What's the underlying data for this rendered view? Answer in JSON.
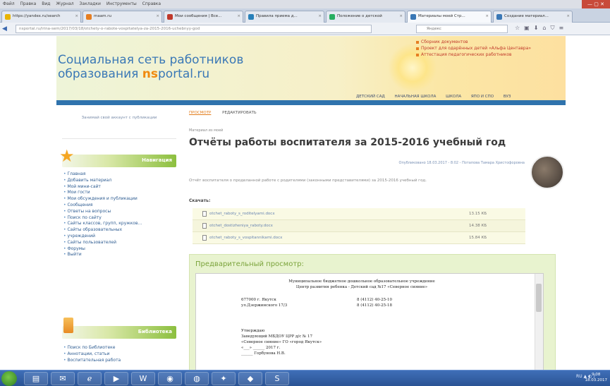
{
  "browser": {
    "menu": [
      "Файл",
      "Правка",
      "Вид",
      "Журнал",
      "Закладки",
      "Инструменты",
      "Справка"
    ],
    "tabs": [
      {
        "label": "https://yandex.ru/search",
        "active": false,
        "color": "#e9b400"
      },
      {
        "label": "maam.ru",
        "active": false,
        "color": "#e67e22"
      },
      {
        "label": "Мои сообщения | Все...",
        "active": false,
        "color": "#c0392b"
      },
      {
        "label": "Правила приема д...",
        "active": false,
        "color": "#2980b9"
      },
      {
        "label": "Положение о детской",
        "active": false,
        "color": "#27ae60"
      },
      {
        "label": "Материалы моей Стр...",
        "active": true,
        "color": "#3a78b6"
      },
      {
        "label": "Создание материал...",
        "active": false,
        "color": "#3a78b6"
      }
    ],
    "url": "nsportal.ru/irina-sem/2017/03/18/otchety-o-rabote-vospitatelya-za-2015-2016-uchebnyy-god",
    "search_placeholder": "Яндекс",
    "window_controls": "— ▢ ✕"
  },
  "header": {
    "logo_line1": "Социальная сеть работников",
    "logo_line2_a": "образования ",
    "logo_line2_b": "ns",
    "logo_line2_c": "portal.ru",
    "links": [
      "Сборник документов",
      "Проект для одарённых детей «Альфа Центавра»",
      "Аттестация педагогических работников"
    ],
    "categories": [
      "ДЕТСКИЙ САД",
      "НАЧАЛЬНАЯ ШКОЛА",
      "ШКОЛА",
      "ЯПО И СПО",
      "ВУЗ"
    ]
  },
  "sidebar": {
    "promo": "Занимай свой аккаунт с публикации",
    "nav_title": "Навигация",
    "nav_items": [
      "Главная",
      "Добавить материал",
      "Мой мини-сайт",
      "Мои гости",
      "Мои обсуждения и публикации",
      "Сообщения",
      "Ответы на вопросы",
      "Поиск по сайту",
      "Сайты классов, групп, кружков...",
      "Сайты образовательных",
      "учреждений",
      "Сайты пользователей",
      "Форумы",
      "Выйти"
    ],
    "lib_title": "Библиотека",
    "lib_items": [
      "Поиск по Библиотеке",
      "Аннотации, статьи",
      "Воспитательная работа"
    ]
  },
  "content": {
    "view_tabs": [
      "ПРОСМОТР",
      "РЕДАКТИРОВАТЬ"
    ],
    "breadcrumb": "Материал из моей",
    "title": "Отчёты работы воспитателя за 2015-2016 учебный год",
    "meta": "Опубликовано 18.03.2017 - 8:02 - Потапова Тамара Христофоровна",
    "description": "Отчёт воспитателя о проделанной работе с родителями (законными представителями) за 2015-2016 учебный год.",
    "download_label": "Скачать:",
    "files": [
      {
        "name": "otchet_raboty_s_roditelyami.docx",
        "size": "13.15 КБ"
      },
      {
        "name": "otchet_dostizheniya_raboty.docx",
        "size": "14.38 КБ"
      },
      {
        "name": "otchet_raboty_s_vospitannikami.docx",
        "size": "15.84 КБ"
      }
    ],
    "preview_title": "Предварительный просмотр:",
    "doc": {
      "line1": "Муниципальное бюджетное дошкольное образовательное учреждение",
      "line2": "Центр развития ребенка - Детский сад №17 «Северное сияние»",
      "addr1": "677000 г. Якутск",
      "addr2": "ул.Дзержинского 17/3",
      "phone1": "8 (4112) 40-25-10",
      "phone2": "8 (4112) 40-25-18",
      "approve": "Утверждаю",
      "approve2": "Заведующий МБДОУ ЦРР д/с № 17",
      "approve3": "«Северное сияние» ГО «город Якутск»",
      "approve4": "«___» ______ 2017 г.",
      "approve5": "______ Горбунова Н.В."
    }
  },
  "taskbar": {
    "tray": "RU  ▲ ◐ ♪",
    "time": "9:08",
    "date": "18.03.2017"
  }
}
